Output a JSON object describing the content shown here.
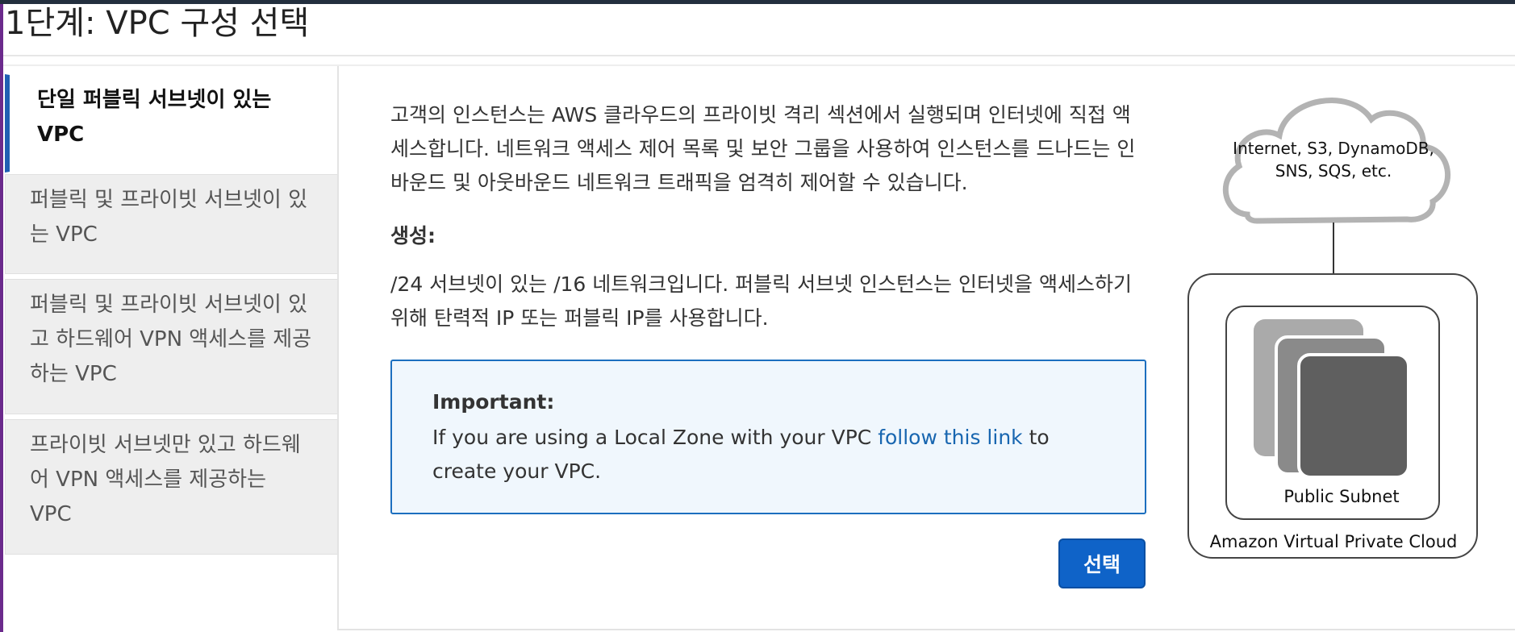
{
  "page": {
    "title": "1단계: VPC 구성 선택"
  },
  "sidebar": {
    "items": [
      {
        "label": "단일 퍼블릭 서브넷이 있는 VPC",
        "active": true
      },
      {
        "label": "퍼블릭 및 프라이빗 서브넷이 있는 VPC",
        "active": false
      },
      {
        "label": "퍼블릭 및 프라이빗 서브넷이 있고 하드웨어 VPN 액세스를 제공하는 VPC",
        "active": false
      },
      {
        "label": "프라이빗 서브넷만 있고 하드웨어 VPN 액세스를 제공하는 VPC",
        "active": false
      }
    ]
  },
  "main": {
    "description": "고객의 인스턴스는 AWS 클라우드의 프라이빗 격리 섹션에서 실행되며 인터넷에 직접 액세스합니다. 네트워크 액세스 제어 목록 및 보안 그룹을 사용하여 인스턴스를 드나드는 인바운드 및 아웃바운드 네트워크 트래픽을 엄격히 제어할 수 있습니다.",
    "create_label": "생성:",
    "create_description": "/24 서브넷이 있는 /16 네트워크입니다. 퍼블릭 서브넷 인스턴스는 인터넷을 액세스하기 위해 탄력적 IP 또는 퍼블릭 IP를 사용합니다.",
    "important": {
      "title": "Important:",
      "text_before": "If you are using a Local Zone with your VPC ",
      "link_text": "follow this link",
      "text_after": " to create your VPC."
    },
    "select_button": "선택"
  },
  "diagram": {
    "cloud_label": "Internet, S3, DynamoDB, SNS, SQS, etc.",
    "subnet_label": "Public Subnet",
    "vpc_label": "Amazon Virtual Private Cloud"
  },
  "colors": {
    "accent": "#1f5fb3",
    "button": "#0f63c8",
    "link": "#1866b0",
    "important_bg": "#f0f7fd",
    "important_border": "#1c6fbf"
  }
}
